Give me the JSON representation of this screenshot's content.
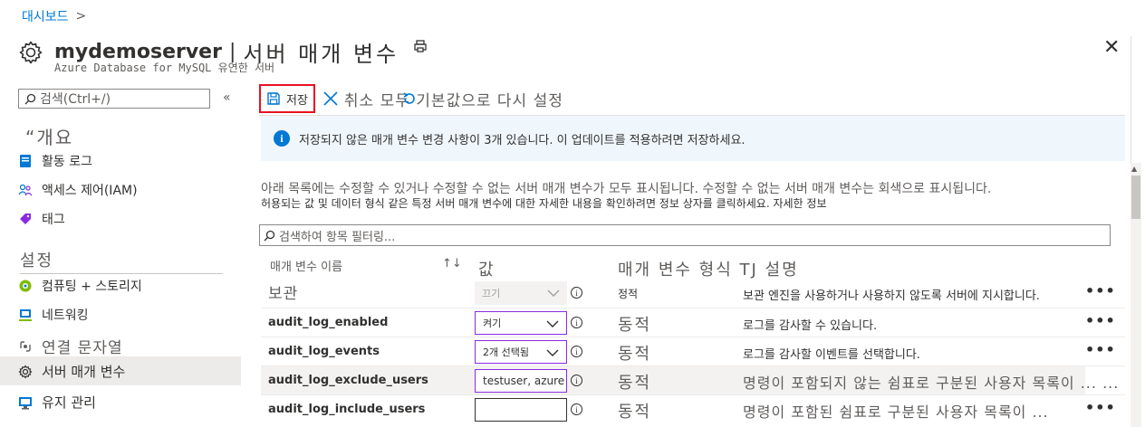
{
  "breadcrumb": {
    "item": "대시보드",
    "chevron": ">"
  },
  "header": {
    "server_name": "mydemoserver",
    "separator": "|",
    "page_title": "서버 매개 변수",
    "subtitle": "Azure Database for MySQL 유연한 서버",
    "close": "✕"
  },
  "sidebar": {
    "search_placeholder": "검색(Ctrl+/)",
    "collapse": "«",
    "overview": "“개요",
    "items_top": [
      {
        "label": "활동 로그",
        "icon": "activity-log-icon"
      },
      {
        "label": "액세스 제어(IAM)",
        "icon": "people-icon"
      },
      {
        "label": "태그",
        "icon": "tag-icon"
      }
    ],
    "section": "설정",
    "items_settings": [
      {
        "label": "컴퓨팅 +  스토리지",
        "icon": "compute-icon"
      },
      {
        "label": "네트워킹",
        "icon": "network-icon"
      },
      {
        "label": "연결 문자열",
        "icon": "connection-icon"
      },
      {
        "label": "서버 매개 변수",
        "icon": "gear-icon",
        "selected": true
      },
      {
        "label": "유지 관리",
        "icon": "maintenance-icon"
      }
    ]
  },
  "toolbar": {
    "save": "저장",
    "discard": "취소 모두 기본값으로 다시 설정"
  },
  "banner": {
    "text": "저장되지 않은 매개 변수 변경 사항이 3개 있습니다. 이 업데이트를 적용하려면 저장하세요."
  },
  "description": {
    "line1": "아래 목록에는 수정할 수 있거나 수정할 수 없는 서버 매개 변수가 모두 표시됩니다. 수정할 수 없는 서버 매개 변수는 회색으로 표시됩니다.",
    "line2": "허용되는 값 및 데이터 형식 같은 특정 서버 매개 변수에 대한 자세한 내용을 확인하려면 정보 상자를 클릭하세요. 자세한 정보"
  },
  "filter": {
    "placeholder": "검색하여 항목 필터링..."
  },
  "table": {
    "headers": {
      "name": "매개 변수 이름",
      "sort": "↑↓",
      "value": "값",
      "type": "매개 변수 형식 TJ 설명"
    },
    "rows": [
      {
        "name": "보관",
        "value": "끄기",
        "type": "정적",
        "desc": "보관 엔진을 사용하거나 사용하지 않도록 서버에 지시합니다.",
        "disabled": true
      },
      {
        "name": "audit_log_enabled",
        "value": "켜기",
        "type": "동적",
        "desc": "로그를 감사할 수 있습니다.",
        "dropdown": true
      },
      {
        "name": "audit_log_events",
        "value": "2개 선택됨",
        "type": "동적",
        "desc": "로그를 감사할 이벤트를 선택합니다.",
        "dropdown": true
      },
      {
        "name": "audit_log_exclude_users",
        "value": "testuser, azure",
        "type": "동적",
        "desc": "명령이 포함되지 않는 쉼표로 구분된 사용자 목록이 ... ...",
        "highlight": true
      },
      {
        "name": "audit_log_include_users",
        "value": "",
        "type": "동적",
        "desc": "명령이 포함된 쉼표로 구분된 사용자 목록이 ..."
      }
    ],
    "more": "•••"
  },
  "colors": {
    "accent": "#0078d4",
    "save_highlight": "#e81123",
    "banner_bg": "#eff6fc",
    "selected_nav": "#edebe9"
  }
}
